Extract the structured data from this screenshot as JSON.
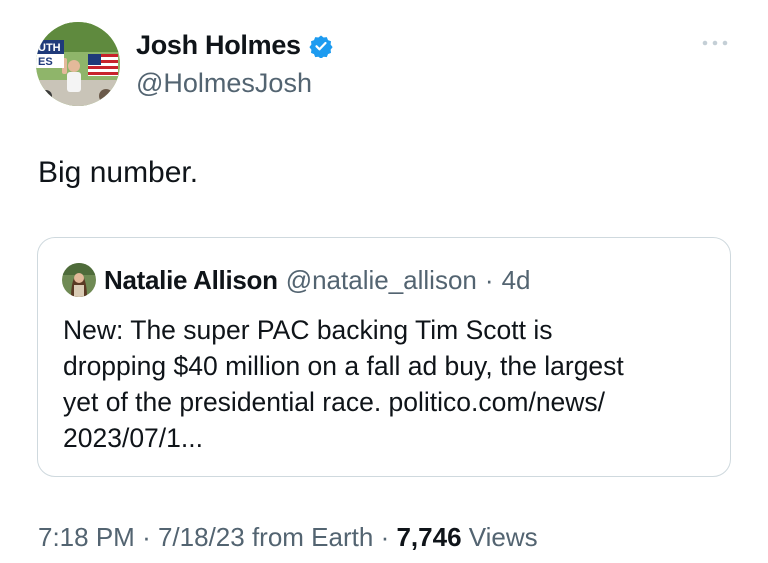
{
  "author": {
    "display_name": "Josh Holmes",
    "handle": "@HolmesJosh",
    "verified": true,
    "avatar_sign_text": "UTH ES"
  },
  "tweet": {
    "text": "Big number."
  },
  "quoted_tweet": {
    "display_name": "Natalie Allison",
    "handle": "@natalie_allison",
    "separator": "·",
    "time": "4d",
    "lines": [
      "New: The super PAC backing Tim Scott is",
      "dropping $40 million on a fall ad buy, the largest",
      "yet of the presidential race. politico.com/news/",
      "2023/07/1..."
    ]
  },
  "meta": {
    "time": "7:18 PM",
    "sep1": "·",
    "date": "7/18/23",
    "source": "from Earth",
    "sep2": "·",
    "views_count": "7,746",
    "views_label": "Views"
  },
  "icons": {
    "verified": "verified-badge-icon",
    "more": "more-options-icon"
  },
  "colors": {
    "verified_blue": "#1d9bf0",
    "secondary_text": "#536471",
    "primary_text": "#0f1419",
    "border": "#cfd9de"
  }
}
